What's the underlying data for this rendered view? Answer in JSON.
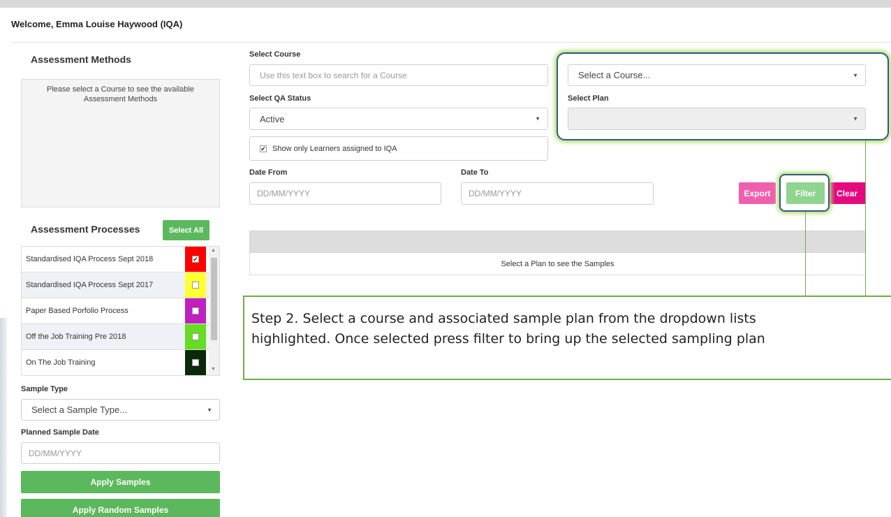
{
  "header": {
    "welcome": "Welcome, Emma Louise Haywood (IQA)"
  },
  "left": {
    "methods_title": "Assessment Methods",
    "methods_message": "Please select a Course to see the available Assessment Methods",
    "processes_title": "Assessment Processes",
    "select_all": "Select All",
    "processes": [
      {
        "label": "Standardised IQA Process Sept 2018",
        "color": "#ff0000",
        "checked": true
      },
      {
        "label": "Standardised IQA Process Sept 2017",
        "color": "#ffff33",
        "checked": false
      },
      {
        "label": "Paper Based Porfolio Process",
        "color": "#c020c0",
        "checked": false
      },
      {
        "label": "Off the Job Training Pre 2018",
        "color": "#66dd22",
        "checked": false
      },
      {
        "label": "On The Job Training",
        "color": "#0a2a0a",
        "checked": false
      }
    ],
    "sample_type_label": "Sample Type",
    "sample_type_value": "Select a Sample Type...",
    "planned_date_label": "Planned Sample Date",
    "planned_date_placeholder": "DD/MM/YYYY",
    "apply_samples": "Apply Samples",
    "apply_random": "Apply Random Samples"
  },
  "filters": {
    "course_label": "Select Course",
    "course_search_placeholder": "Use this text box to search for a Course",
    "course_select": "Select a Course...",
    "qa_status_label": "Select QA Status",
    "qa_status_value": "Active",
    "plan_label": "Select Plan",
    "plan_value": "",
    "only_assigned": "Show only Learners assigned to IQA",
    "only_assigned_checked": true,
    "date_from_label": "Date From",
    "date_from_placeholder": "DD/MM/YYYY",
    "date_to_label": "Date To",
    "date_to_placeholder": "DD/MM/YYYY",
    "export": "Export",
    "filter": "Filter",
    "clear": "Clear"
  },
  "samples": {
    "empty_message": "Select a Plan to see the Samples"
  },
  "callout": {
    "line1": "Step 2. Select a course and associated sample plan from the dropdown lists",
    "line2": "highlighted. Once selected press filter to bring up the selected sampling plan"
  },
  "colors": {
    "accent_green": "#5cb85c",
    "export_pink": "#f05fae",
    "clear_magenta": "#e5097f",
    "filter_light_green": "#8fd48f",
    "callout_border": "#70ad47"
  },
  "icons": {
    "caret": "caret-down-icon",
    "check": "check-icon"
  }
}
